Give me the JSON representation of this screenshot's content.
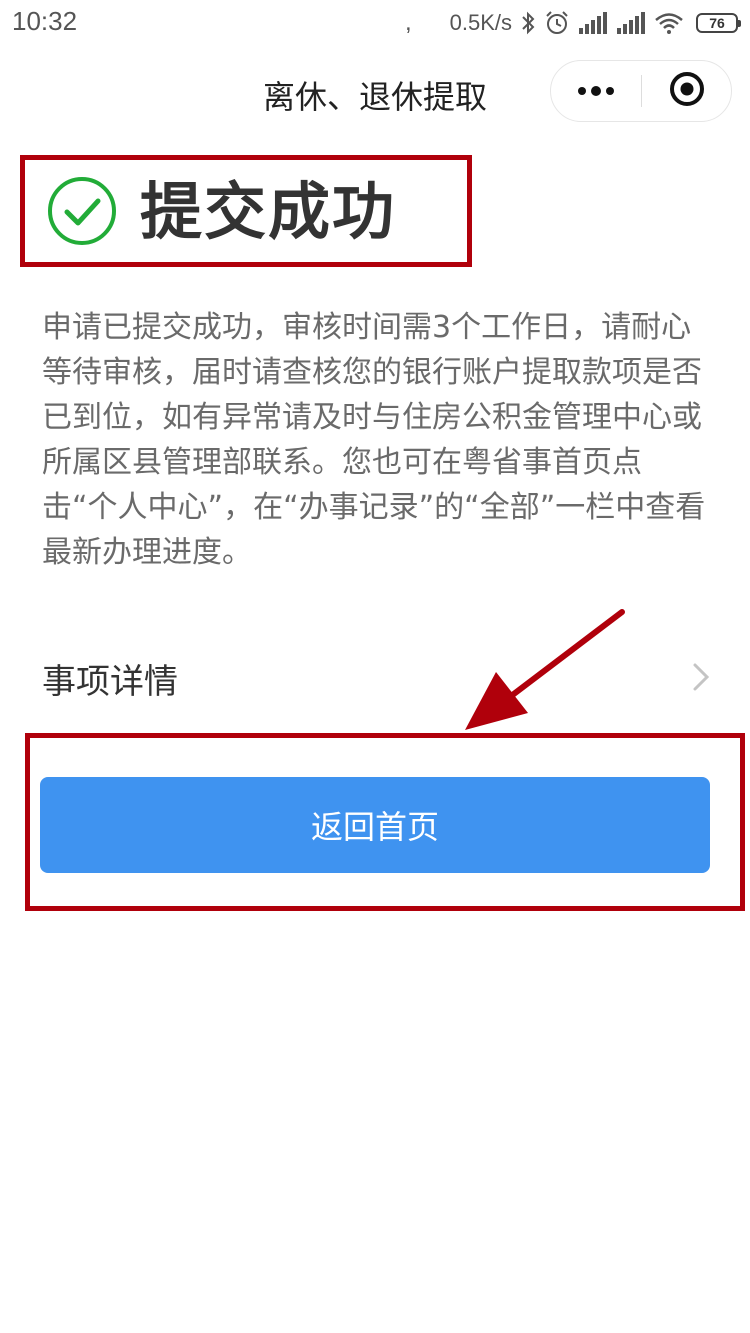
{
  "status_bar": {
    "time": "10:32",
    "separator": ",",
    "net_speed": "0.5K/s",
    "battery": "76",
    "icons": [
      "bluetooth-icon",
      "alarm-icon",
      "signal-icon",
      "signal-icon",
      "wifi-icon",
      "battery-icon"
    ]
  },
  "nav": {
    "title": "离休、退休提取",
    "icons": [
      "more-icon",
      "close-mini-program-icon"
    ]
  },
  "result": {
    "title": "提交成功",
    "icon": "success-check-icon",
    "message": "申请已提交成功，审核时间需3个工作日，请耐心等待审核，届时请查核您的银行账户提取款项是否已到位，如有异常请及时与住房公积金管理中心或所属区县管理部联系。您也可在粤省事首页点击“个人中心”，在“办事记录”的“全部”一栏中查看最新办理进度。"
  },
  "details": {
    "label": "事项详情",
    "icon": "chevron-right-icon"
  },
  "actions": {
    "home_label": "返回首页"
  },
  "colors": {
    "primary_button": "#3f93f0",
    "success_green": "#22ac38",
    "annotation_red": "#b0000b"
  }
}
